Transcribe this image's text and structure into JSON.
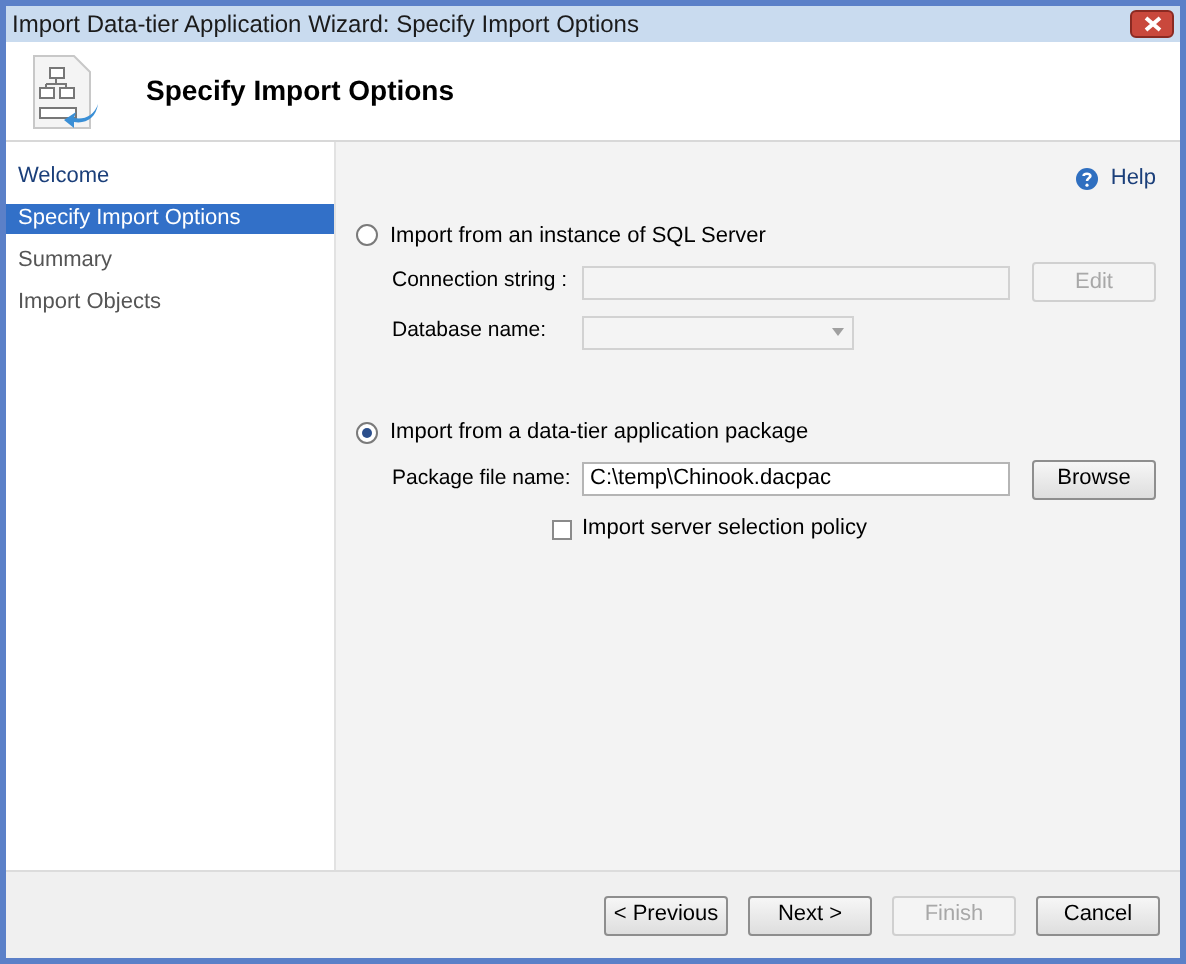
{
  "window": {
    "title": "Import Data-tier Application Wizard: Specify Import Options"
  },
  "header": {
    "title": "Specify Import Options"
  },
  "sidebar": {
    "items": [
      {
        "label": "Welcome",
        "selected": false,
        "disabled": false
      },
      {
        "label": "Specify Import Options",
        "selected": true,
        "disabled": false
      },
      {
        "label": "Summary",
        "selected": false,
        "disabled": true
      },
      {
        "label": "Import Objects",
        "selected": false,
        "disabled": true
      }
    ]
  },
  "help": {
    "label": "Help"
  },
  "options": [
    {
      "label": "Import from an instance of SQL Server",
      "selected": false,
      "fields": [
        {
          "kind": "text",
          "label": "Connection string :",
          "disabled": true,
          "button": {
            "label": "Edit",
            "disabled": true
          }
        },
        {
          "kind": "dropdown",
          "label": "Database name:",
          "disabled": true
        }
      ]
    },
    {
      "label": "Import from a data-tier application package",
      "selected": true,
      "fields": [
        {
          "kind": "text",
          "label": "Package file name:",
          "value": "C:\\temp\\Chinook.dacpac",
          "disabled": false,
          "button": {
            "label": "Browse",
            "disabled": false
          }
        },
        {
          "kind": "checkbox",
          "label": "Import server selection policy",
          "checked": false
        }
      ]
    }
  ],
  "buttons": [
    {
      "label": "< Previous",
      "disabled": false
    },
    {
      "label": "Next >",
      "disabled": false
    },
    {
      "label": "Finish",
      "disabled": true
    },
    {
      "label": "Cancel",
      "disabled": false
    }
  ]
}
